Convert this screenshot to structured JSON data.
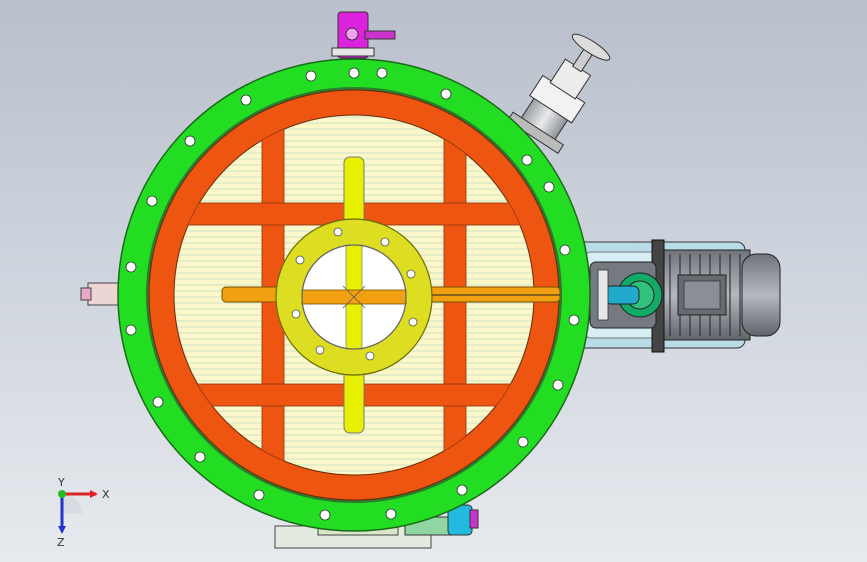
{
  "triad": {
    "x_label": "X",
    "y_label": "Y",
    "z_label": "Z"
  },
  "colors": {
    "background_top": "#b9c0cb",
    "background_bottom": "#e7eaee",
    "flange_green": "#22dd22",
    "shell_orange": "#ee5511",
    "ring_yellow": "#dddd22",
    "shaft_orange": "#f0a010",
    "stem_yellow": "#e6f000",
    "filter_cream": "#fff8c8",
    "handle_magenta": "#dd22dd",
    "motor_gray": "#8a8f96",
    "pipe_cyan": "#22aacc"
  },
  "icons": [
    "triad-axis-icon"
  ]
}
